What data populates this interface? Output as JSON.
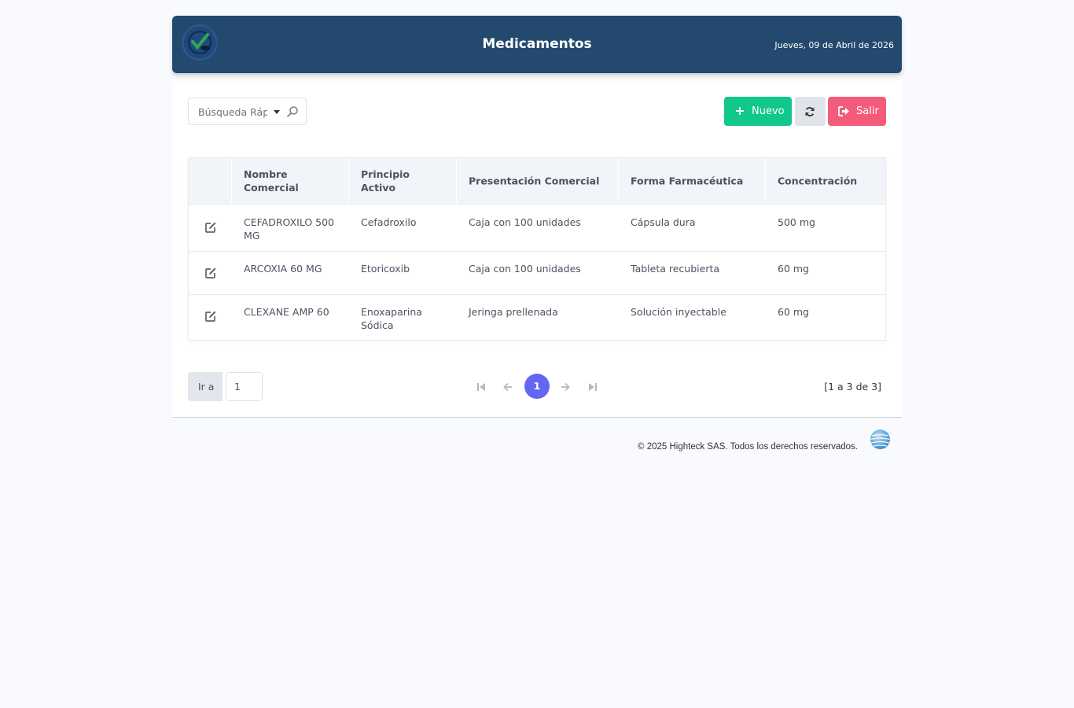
{
  "header": {
    "title": "Medicamentos",
    "date": "Jueves, 09 de Abril de 2026",
    "logo_icon": "pharmacy-logo"
  },
  "toolbar": {
    "search_placeholder": "Búsqueda Rápida",
    "search_visible": "Búsqueda Rápic",
    "new_label": "Nuevo",
    "exit_label": "Salir",
    "colors": {
      "new": "#12c78b",
      "refresh": "#dfe4ea",
      "exit": "#f45b7a"
    }
  },
  "table": {
    "columns": [
      "",
      "Nombre Comercial",
      "Principio Activo",
      "Presentación Comercial",
      "Forma Farmacéutica",
      "Concentración"
    ],
    "rows": [
      {
        "nombre": "CEFADROXILO 500 MG",
        "principio": "Cefadroxilo",
        "presentacion": "Caja con 100 unidades",
        "forma": "Cápsula dura",
        "concentracion": "500 mg"
      },
      {
        "nombre": "ARCOXIA 60 MG",
        "principio": "Etoricoxib",
        "presentacion": "Caja con 100 unidades",
        "forma": "Tableta recubierta",
        "concentracion": "60 mg"
      },
      {
        "nombre": "CLEXANE AMP 60",
        "principio": "Enoxaparina Sódica",
        "presentacion": "Jeringa prellenada",
        "forma": "Solución inyectable",
        "concentracion": "60 mg"
      }
    ]
  },
  "pager": {
    "goto_label": "Ir a",
    "goto_value": "1",
    "current_page": "1",
    "range": "[1 a 3 de 3]"
  },
  "footer": {
    "copyright": "© 2025 Highteck SAS. Todos los derechos reservados."
  }
}
